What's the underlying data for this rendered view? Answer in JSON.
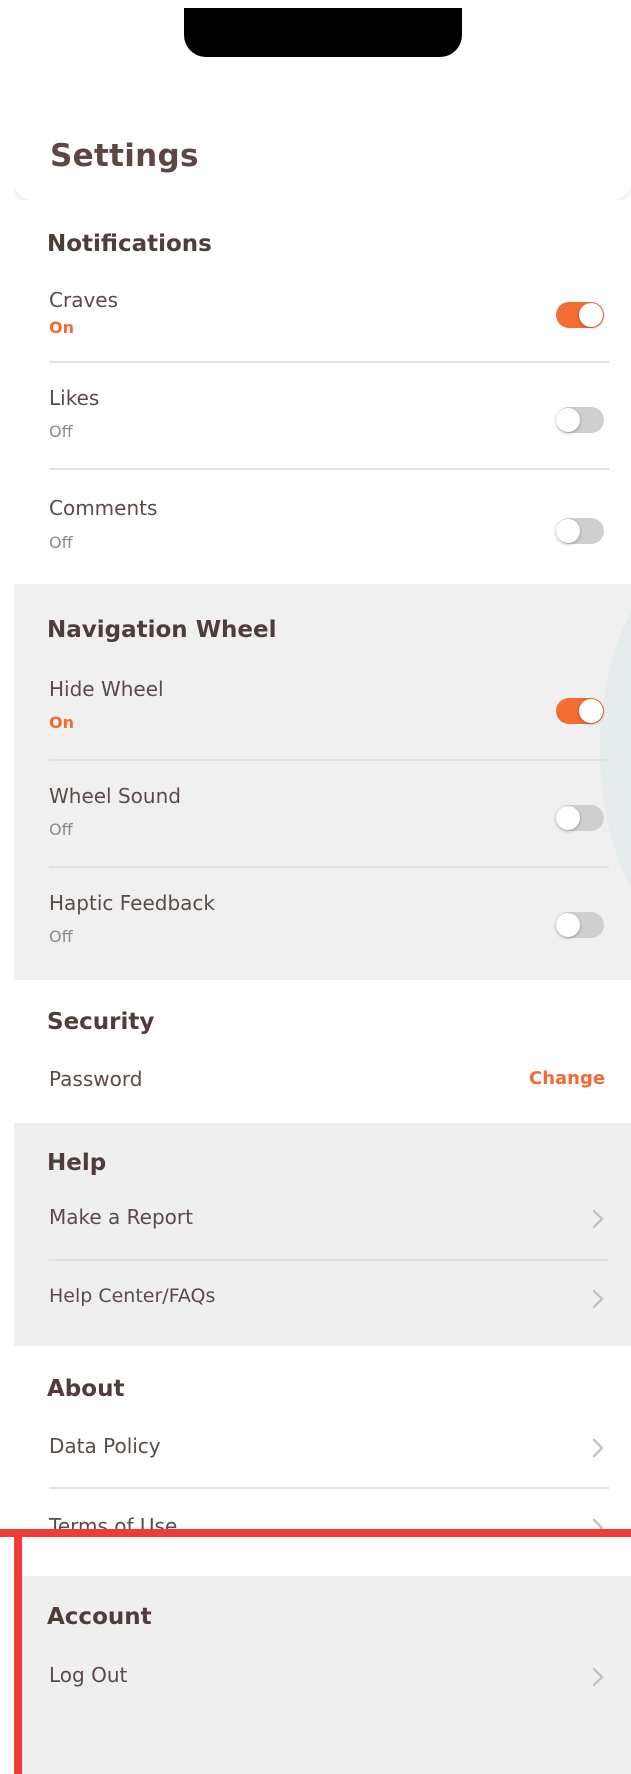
{
  "header": {
    "title": "Settings"
  },
  "notifications": {
    "title": "Notifications",
    "items": [
      {
        "label": "Craves",
        "status": "On"
      },
      {
        "label": "Likes",
        "status": "Off"
      },
      {
        "label": "Comments",
        "status": "Off"
      }
    ]
  },
  "navigation_wheel": {
    "title": "Navigation Wheel",
    "items": [
      {
        "label": "Hide Wheel",
        "status": "On"
      },
      {
        "label": "Wheel Sound",
        "status": "Off"
      },
      {
        "label": "Haptic Feedback",
        "status": "Off"
      }
    ]
  },
  "security": {
    "title": "Security",
    "password_label": "Password",
    "change_label": "Change"
  },
  "help": {
    "title": "Help",
    "items": [
      {
        "label": "Make a Report"
      },
      {
        "label": "Help Center/FAQs"
      }
    ]
  },
  "about": {
    "title": "About",
    "items": [
      {
        "label": "Data Policy"
      },
      {
        "label": "Terms of Use"
      }
    ]
  },
  "account": {
    "title": "Account",
    "items": [
      {
        "label": "Log Out"
      }
    ]
  },
  "colors": {
    "accent": "#f06a32",
    "highlight": "#f03b3b",
    "teal": "#2bb3c3"
  }
}
